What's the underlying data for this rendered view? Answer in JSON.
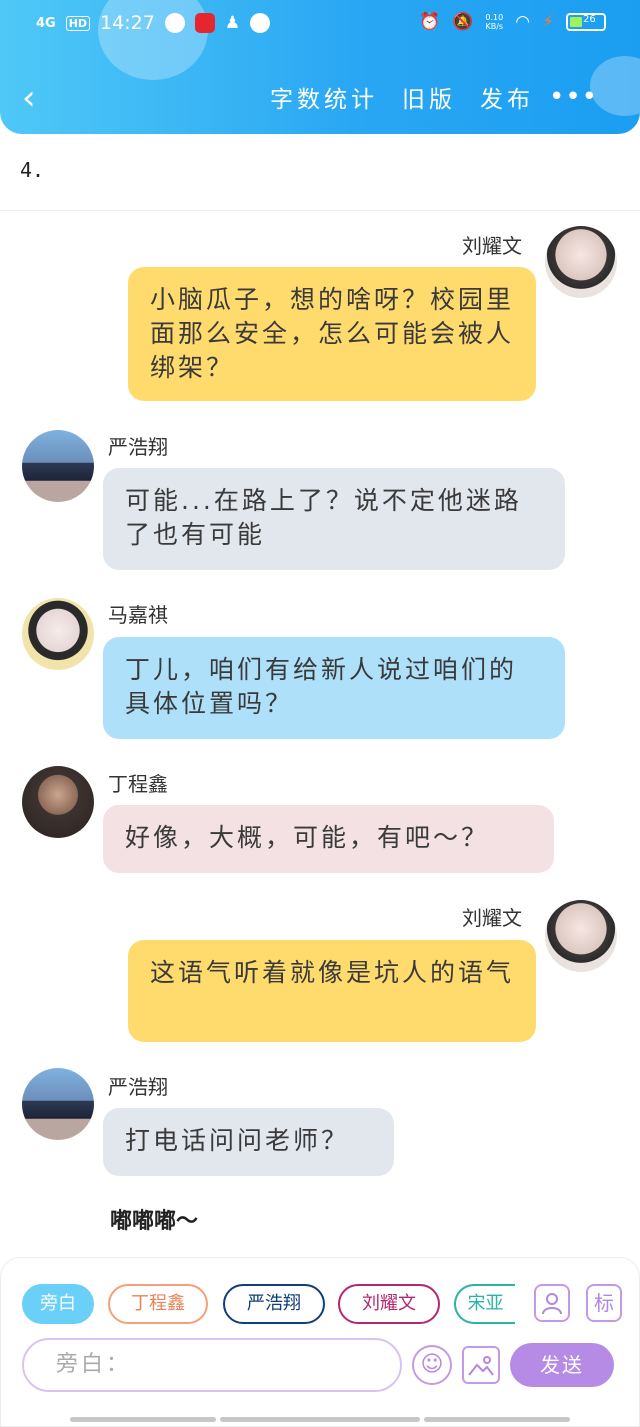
{
  "status_bar": {
    "network": "4G",
    "time": "14:27",
    "hd": "HD",
    "speed_value": "0.10",
    "speed_unit": "KB/s",
    "battery": "26"
  },
  "header": {
    "back_icon": "back-arrow-icon",
    "actions": [
      "字数统计",
      "旧版",
      "发布"
    ],
    "more_label": "•••"
  },
  "chapter_label": "4.",
  "messages": [
    {
      "speaker": "刘耀文",
      "side": "right",
      "color": "#ffdb6e",
      "text": "小脑瓜子，想的啥呀？校园里面那么安全，怎么可能会被人绑架？"
    },
    {
      "speaker": "严浩翔",
      "side": "left",
      "color": "#e2e7ee",
      "text": "可能...在路上了？说不定他迷路了也有可能"
    },
    {
      "speaker": "马嘉祺",
      "side": "left",
      "color": "#aee0fa",
      "text": "丁儿，咱们有给新人说过咱们的具体位置吗？"
    },
    {
      "speaker": "丁程鑫",
      "side": "left",
      "color": "#f3e1e3",
      "text": "好像，大概，可能，有吧～？"
    },
    {
      "speaker": "刘耀文",
      "side": "right",
      "color": "#ffdb6e",
      "text": "这语气听着就像是坑人的语气"
    },
    {
      "speaker": "严浩翔",
      "side": "left",
      "color": "#e2e7ee",
      "text": "打电话问问老师？"
    }
  ],
  "narration": "嘟嘟嘟～",
  "role_chips": [
    "旁白",
    "丁程鑫",
    "严浩翔",
    "刘耀文",
    "宋亚"
  ],
  "tools": {
    "role_icon": "user-card-icon",
    "tag_label": "标",
    "input_placeholder": "旁白：",
    "emoji_icon": "smile-icon",
    "image_icon": "image-icon",
    "send_label": "发送"
  }
}
